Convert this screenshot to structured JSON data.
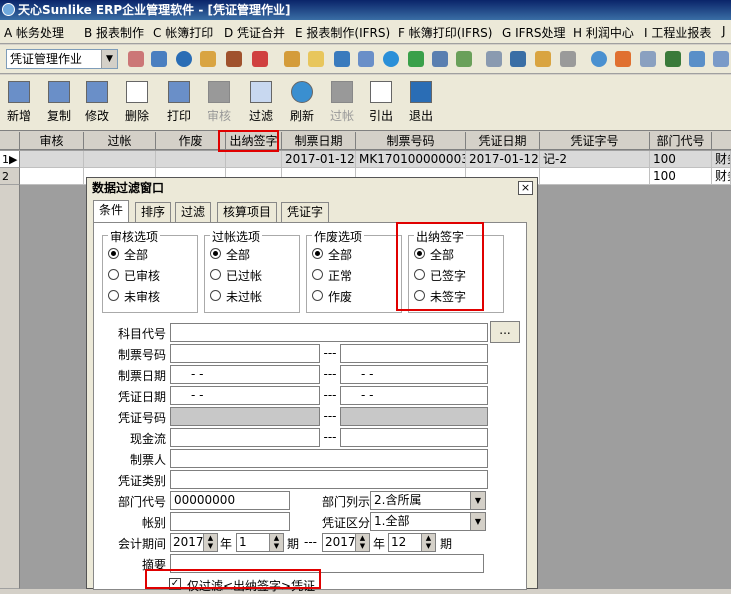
{
  "title": "天心Sunlike ERP企业管理软件 - [凭证管理作业]",
  "menu": [
    "A 帐务处理",
    "B 报表制作",
    "C 帐簿打印",
    "D 凭证合并",
    "E 报表制作(IFRS)",
    "F 帐簿打印(IFRS)",
    "G IFRS处理",
    "H 利润中心",
    "I 工程业报表",
    "J"
  ],
  "combo": {
    "value": "凭证管理作业"
  },
  "toolbar": {
    "buttons": [
      "新增",
      "复制",
      "修改",
      "删除",
      "打印",
      "审核",
      "过滤",
      "刷新",
      "过帐",
      "引出",
      "退出"
    ]
  },
  "grid": {
    "headers": [
      "审核",
      "过帐",
      "作废",
      "出纳签字",
      "制票日期",
      "制票号码",
      "凭证日期",
      "凭证字号",
      "部门代号"
    ],
    "rows": [
      {
        "num": "1",
        "cells": [
          "",
          "",
          "",
          "",
          "2017-01-12",
          "MK170100000003",
          "2017-01-12",
          "记-2",
          "100",
          "财务"
        ]
      },
      {
        "num": "2",
        "cells": [
          "",
          "",
          "",
          "",
          "",
          "",
          "",
          "",
          "100",
          "财务"
        ]
      }
    ]
  },
  "dialog": {
    "title": "数据过滤窗口",
    "close": "×",
    "tabs": [
      "条件",
      "排序",
      "过滤",
      "核算项目",
      "凭证字"
    ],
    "groups": [
      {
        "title": "审核选项",
        "options": [
          "全部",
          "已审核",
          "未审核"
        ],
        "selected": 0
      },
      {
        "title": "过帐选项",
        "options": [
          "全部",
          "已过帐",
          "未过帐"
        ],
        "selected": 0
      },
      {
        "title": "作废选项",
        "options": [
          "全部",
          "正常",
          "作废"
        ],
        "selected": 0
      },
      {
        "title": "出纳签字",
        "options": [
          "全部",
          "已签字",
          "未签字"
        ],
        "selected": 0
      }
    ],
    "fields": {
      "subject_code": "科目代号",
      "browse": "...",
      "voucher_no": "制票号码",
      "voucher_date": "制票日期",
      "date_placeholder": "- -",
      "cert_date": "凭证日期",
      "cert_no": "凭证号码",
      "cash_flow": "现金流",
      "maker": "制票人",
      "cert_type": "凭证类别",
      "dept_code": "部门代号",
      "dept_code_value": "00000000",
      "dept_list": "部门列示",
      "dept_list_value": "2.含所属",
      "account": "帐别",
      "cert_zone": "凭证区分",
      "cert_zone_value": "1.全部",
      "period": "会计期间",
      "year1": "2017",
      "month1": "1",
      "year2": "2017",
      "month2": "12",
      "year_unit": "年",
      "period_unit": "期",
      "summary": "摘要",
      "dash": "---"
    },
    "checkbox": {
      "label": "仅过滤<出纳签字>凭证",
      "checked": true
    }
  }
}
